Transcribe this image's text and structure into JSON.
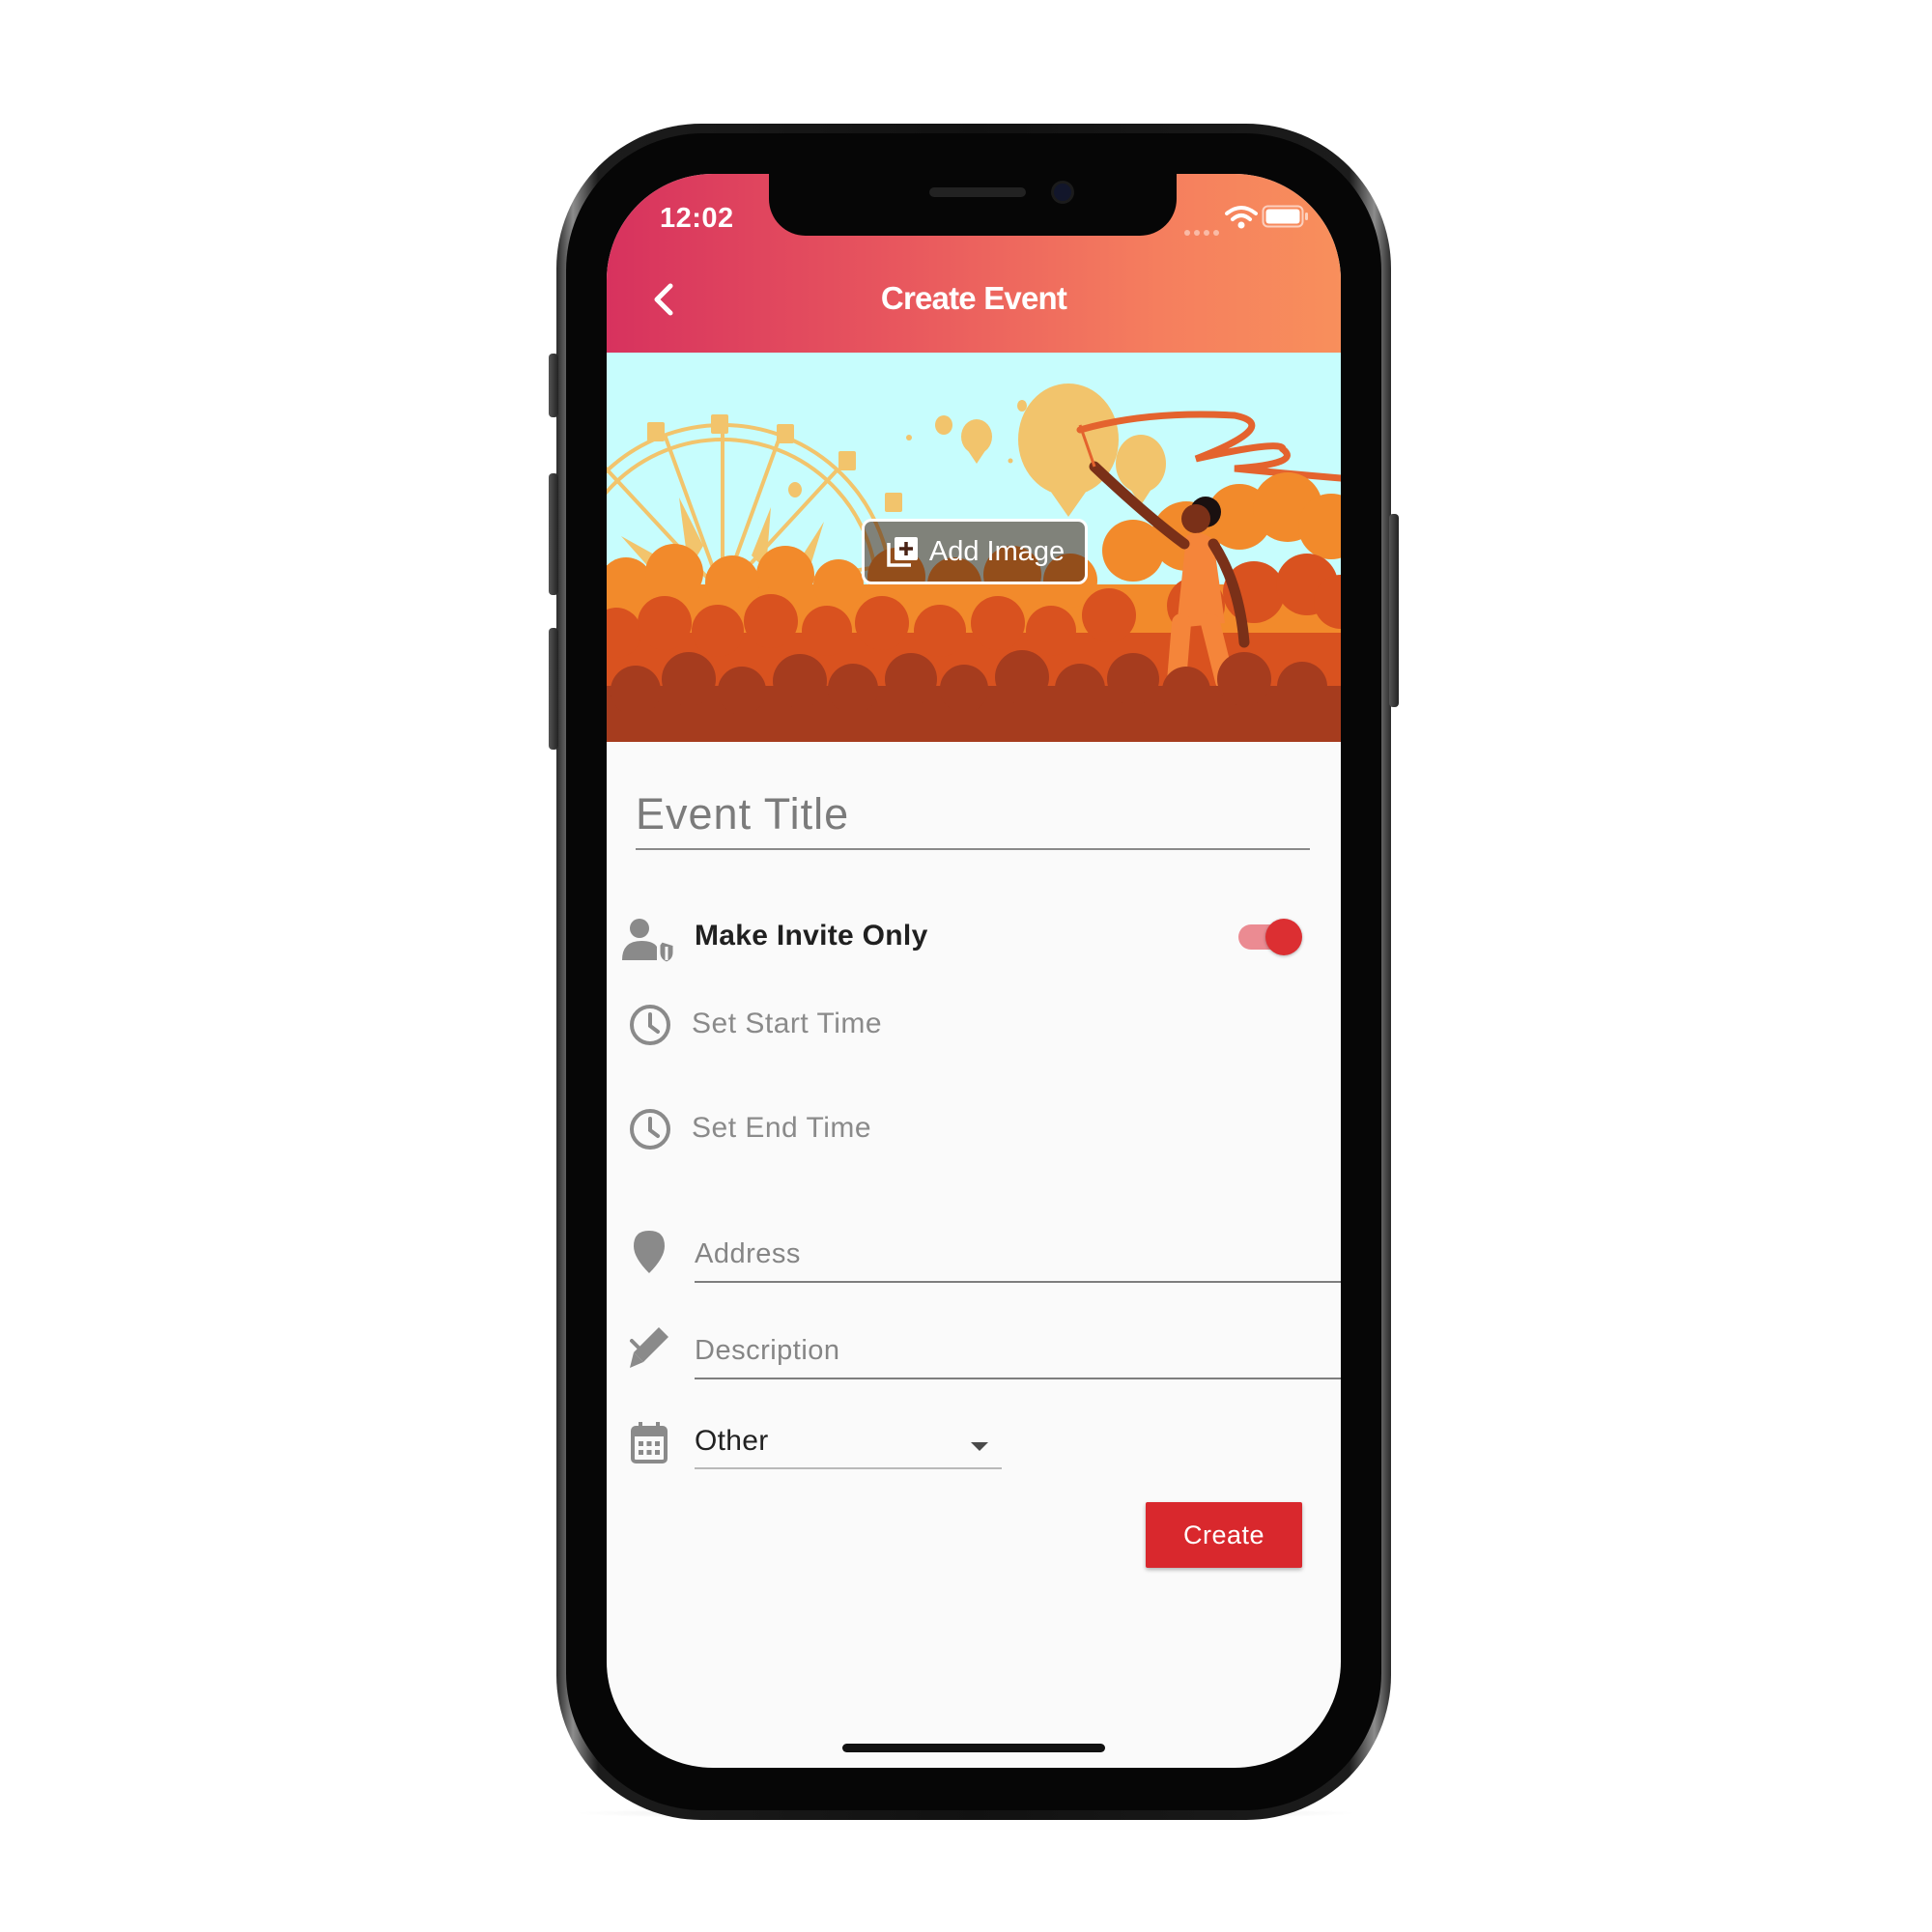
{
  "status_bar": {
    "time": "12:02"
  },
  "app_bar": {
    "title": "Create Event",
    "back_icon": "chevron-left-icon"
  },
  "banner": {
    "add_image_label": "Add Image",
    "add_image_icon": "add-to-photos-icon"
  },
  "form": {
    "event_title_placeholder": "Event Title",
    "invite_only": {
      "label": "Make Invite Only",
      "enabled": true,
      "icon": "user-shield-icon"
    },
    "start_time_label": "Set Start Time",
    "end_time_label": "Set End Time",
    "address_placeholder": "Address",
    "description_placeholder": "Description",
    "category": {
      "selected": "Other",
      "icon": "calendar-icon"
    },
    "create_label": "Create"
  },
  "colors": {
    "header_gradient_start": "#d7325e",
    "header_gradient_end": "#f88f5c",
    "accent_red": "#d9282d",
    "toggle_track": "#eb8b92",
    "banner_sky": "#c7fdfd"
  }
}
